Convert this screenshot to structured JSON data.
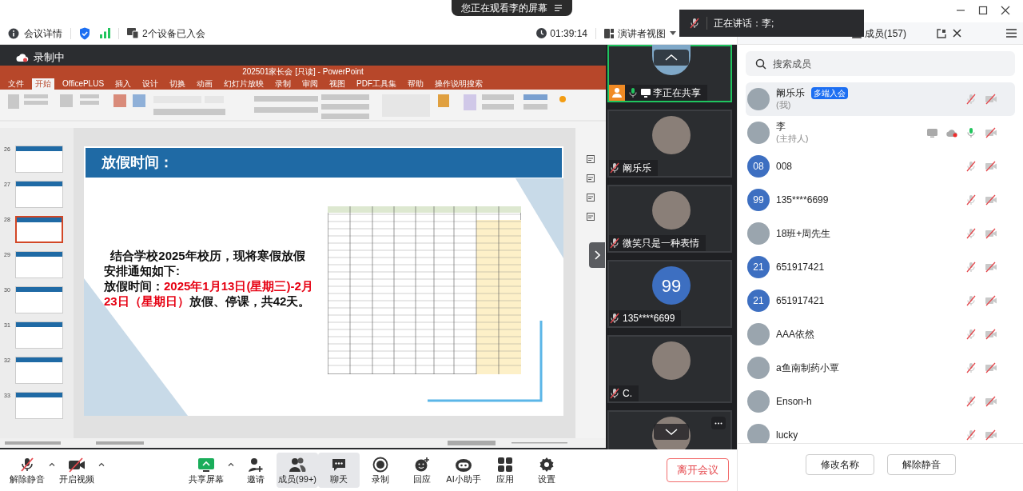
{
  "top_bar": {
    "sharing_notice": "您正在观看李的屏幕"
  },
  "info_bar": {
    "meeting_details": "会议详情",
    "devices": "2个设备已入会",
    "duration": "01:39:14",
    "view_mode": "演讲者视图"
  },
  "speaking_toast": {
    "text": "正在讲话：李;"
  },
  "shared_screen": {
    "recording_label": "录制中",
    "powerpoint": {
      "title": "202501家长会 [只读] - PowerPoint",
      "tabs": [
        {
          "label": "文件",
          "selected": false
        },
        {
          "label": "开始",
          "selected": true
        },
        {
          "label": "OfficePLUS",
          "selected": false
        },
        {
          "label": "插入",
          "selected": false
        },
        {
          "label": "设计",
          "selected": false
        },
        {
          "label": "切换",
          "selected": false
        },
        {
          "label": "动画",
          "selected": false
        },
        {
          "label": "幻灯片放映",
          "selected": false
        },
        {
          "label": "录制",
          "selected": false
        },
        {
          "label": "审阅",
          "selected": false
        },
        {
          "label": "视图",
          "selected": false
        },
        {
          "label": "PDF工具集",
          "selected": false
        },
        {
          "label": "帮助",
          "selected": false
        },
        {
          "label": "操作说明搜索",
          "selected": false
        }
      ],
      "thumbnails": [
        {
          "number": "26",
          "selected": false
        },
        {
          "number": "27",
          "selected": false
        },
        {
          "number": "28",
          "selected": true
        },
        {
          "number": "29",
          "selected": false
        },
        {
          "number": "30",
          "selected": false
        },
        {
          "number": "31",
          "selected": false
        },
        {
          "number": "32",
          "selected": false
        },
        {
          "number": "33",
          "selected": false
        }
      ],
      "slide": {
        "title": "放假时间：",
        "body": [
          {
            "text": "  结合学校2025年校历，现将寒假放假安排通知如下:",
            "highlight": false
          },
          {
            "text": "放假时间：",
            "highlight": false
          },
          {
            "text": "2025年1月13日(星期三)-2月23日（星期日）",
            "highlight": true
          },
          {
            "text": "放假、停课，共42天。",
            "highlight": false
          }
        ]
      }
    }
  },
  "video_tiles": [
    {
      "kind": "sharing",
      "name": "李正在共享",
      "active": true,
      "muted": false
    },
    {
      "kind": "photo",
      "name": "阚乐乐",
      "active": false,
      "muted": true
    },
    {
      "kind": "photo",
      "name": "微笑只是一种表情",
      "active": false,
      "muted": true
    },
    {
      "kind": "initials",
      "avatar_text": "99",
      "name": "135****6699",
      "active": false,
      "muted": true
    },
    {
      "kind": "photo",
      "name": "C.",
      "active": false,
      "muted": true
    },
    {
      "kind": "photo",
      "active": false
    }
  ],
  "members": {
    "title": "成员(157)",
    "search_placeholder": "搜索成员",
    "list": [
      {
        "kind": "photo",
        "name": "阚乐乐",
        "role": "(我)",
        "badge": "多端入会",
        "selected": true,
        "sharing": false,
        "recording": false,
        "mic_on": false
      },
      {
        "kind": "photo",
        "name": "李",
        "role": "(主持人)",
        "selected": false,
        "sharing": true,
        "recording": true,
        "mic_on": true
      },
      {
        "kind": "initials",
        "avatar_text": "08",
        "name": "008",
        "selected": false,
        "sharing": false,
        "recording": false,
        "mic_on": false
      },
      {
        "kind": "initials",
        "avatar_text": "99",
        "name": "135****6699",
        "selected": false,
        "sharing": false,
        "recording": false,
        "mic_on": false
      },
      {
        "kind": "photo",
        "name": "18班+周先生",
        "selected": false,
        "sharing": false,
        "recording": false,
        "mic_on": false
      },
      {
        "kind": "initials",
        "avatar_text": "21",
        "name": "651917421",
        "selected": false,
        "sharing": false,
        "recording": false,
        "mic_on": false
      },
      {
        "kind": "initials",
        "avatar_text": "21",
        "name": "651917421",
        "selected": false,
        "sharing": false,
        "recording": false,
        "mic_on": false
      },
      {
        "kind": "photo",
        "name": "AAA依然",
        "selected": false,
        "sharing": false,
        "recording": false,
        "mic_on": false
      },
      {
        "kind": "photo",
        "name": "a鱼南制药小覃",
        "selected": false,
        "sharing": false,
        "recording": false,
        "mic_on": false
      },
      {
        "kind": "photo",
        "name": "Enson-h",
        "selected": false,
        "sharing": false,
        "recording": false,
        "mic_on": false
      },
      {
        "kind": "photo",
        "name": "lucky",
        "selected": false,
        "sharing": false,
        "recording": false,
        "mic_on": false
      }
    ],
    "buttons": [
      "修改名称",
      "解除静音"
    ]
  },
  "toolbar": {
    "left": [
      {
        "kind": "mic",
        "label": "解除静音",
        "has_menu": true,
        "selected": false
      },
      {
        "kind": "camera",
        "label": "开启视频",
        "has_menu": true,
        "selected": false
      }
    ],
    "center": [
      {
        "kind": "share",
        "label": "共享屏幕",
        "has_menu": true,
        "selected": false
      },
      {
        "kind": "invite",
        "label": "邀请",
        "has_menu": false,
        "selected": false
      },
      {
        "kind": "members",
        "label": "成员(99+)",
        "has_menu": false,
        "selected": true
      },
      {
        "kind": "chat",
        "label": "聊天",
        "has_menu": false,
        "selected": true
      },
      {
        "kind": "record",
        "label": "录制",
        "has_menu": false,
        "selected": false
      },
      {
        "kind": "reaction",
        "label": "回应",
        "has_menu": false,
        "selected": false
      },
      {
        "kind": "assistant",
        "label": "AI小助手",
        "has_menu": false,
        "selected": false
      },
      {
        "kind": "apps",
        "label": "应用",
        "has_menu": false,
        "selected": false
      },
      {
        "kind": "settings",
        "label": "设置",
        "has_menu": false,
        "selected": false
      }
    ],
    "leave_button": "离开会议"
  }
}
